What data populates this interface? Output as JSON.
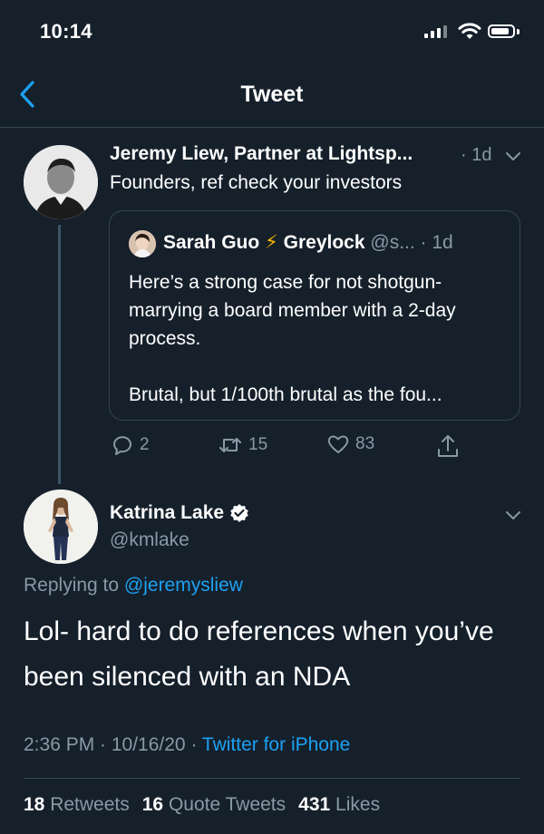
{
  "status_bar": {
    "time": "10:14"
  },
  "header": {
    "title": "Tweet",
    "back_icon": "chevron-left-icon"
  },
  "parent_tweet": {
    "author_name": "Jeremy Liew, Partner at Lightsp...",
    "age": "· 1d",
    "text": "Founders, ref check your investors",
    "quoted_tweet": {
      "author_name": "Sarah Guo",
      "emoji": "⚡",
      "affiliation": "Greylock",
      "handle_age": "@s... · 1d",
      "paragraph_1": "Here’s a strong case for not shotgun-marrying a board member with a 2-day process.",
      "paragraph_2": "Brutal, but 1/100th brutal as the fou..."
    },
    "actions": {
      "replies": "2",
      "retweets": "15",
      "likes": "83"
    }
  },
  "main_tweet": {
    "author_name": "Katrina Lake",
    "handle": "@kmlake",
    "replying_prefix": "Replying to",
    "replying_to": "@jeremysliew",
    "text": "Lol- hard to do references when you’ve been silenced with an NDA",
    "time_date": "2:36 PM · 10/16/20 ·",
    "source": "Twitter for iPhone",
    "stats": {
      "retweets_count": "18",
      "retweets_label": "Retweets",
      "quotes_count": "16",
      "quotes_label": "Quote Tweets",
      "likes_count": "431",
      "likes_label": "Likes"
    }
  },
  "colors": {
    "background": "#15202b",
    "accent": "#1da1f2",
    "muted": "#8899a6",
    "divider": "#38444d"
  }
}
